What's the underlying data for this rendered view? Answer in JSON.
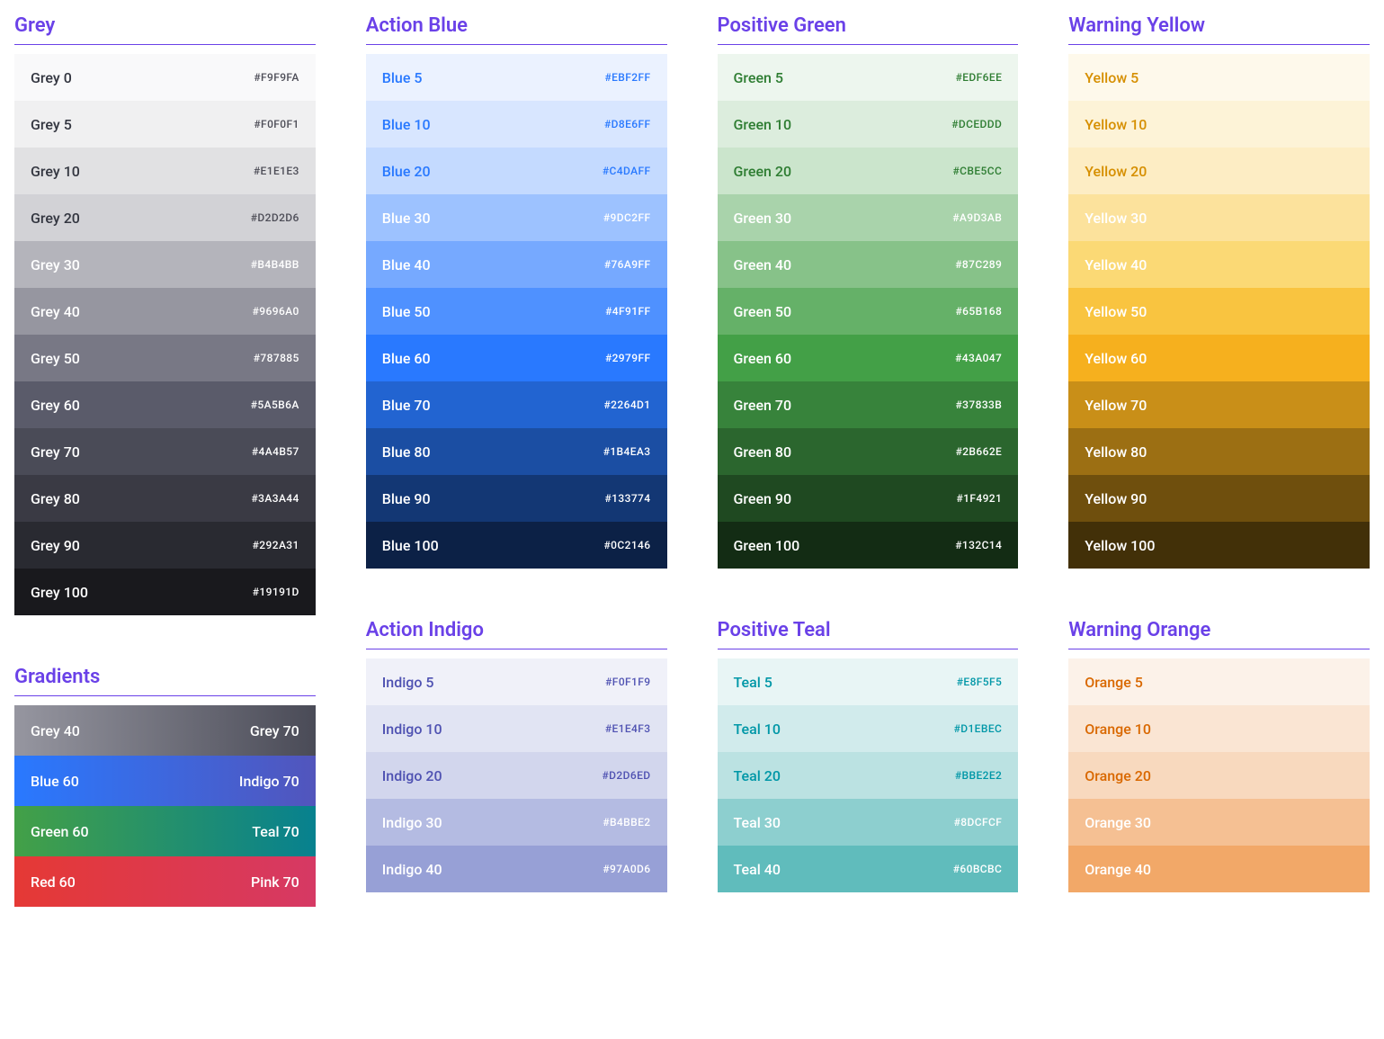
{
  "columns": [
    {
      "groups": [
        {
          "title": "Grey",
          "swatches": [
            {
              "label": "Grey 0",
              "hex": "#F9F9FA",
              "bg": "#F9F9FA",
              "fg": "#333640",
              "hexfg": "#4d4d57"
            },
            {
              "label": "Grey 5",
              "hex": "#F0F0F1",
              "bg": "#F0F0F1",
              "fg": "#333640",
              "hexfg": "#4d4d57"
            },
            {
              "label": "Grey 10",
              "hex": "#E1E1E3",
              "bg": "#E1E1E3",
              "fg": "#333640",
              "hexfg": "#4d4d57"
            },
            {
              "label": "Grey 20",
              "hex": "#D2D2D6",
              "bg": "#D2D2D6",
              "fg": "#333640",
              "hexfg": "#4d4d57"
            },
            {
              "label": "Grey 30",
              "hex": "#B4B4BB",
              "bg": "#B4B4BB",
              "fg": "#ffffff",
              "hexfg": "#ffffff"
            },
            {
              "label": "Grey 40",
              "hex": "#9696A0",
              "bg": "#9696A0",
              "fg": "#ffffff",
              "hexfg": "#ffffff"
            },
            {
              "label": "Grey 50",
              "hex": "#787885",
              "bg": "#787885",
              "fg": "#ffffff",
              "hexfg": "#ffffff"
            },
            {
              "label": "Grey 60",
              "hex": "#5A5B6A",
              "bg": "#5A5B6A",
              "fg": "#ffffff",
              "hexfg": "#ffffff"
            },
            {
              "label": "Grey 70",
              "hex": "#4A4B57",
              "bg": "#4A4B57",
              "fg": "#ffffff",
              "hexfg": "#ffffff"
            },
            {
              "label": "Grey 80",
              "hex": "#3A3A44",
              "bg": "#3A3A44",
              "fg": "#ffffff",
              "hexfg": "#ffffff"
            },
            {
              "label": "Grey 90",
              "hex": "#292A31",
              "bg": "#292A31",
              "fg": "#ffffff",
              "hexfg": "#ffffff"
            },
            {
              "label": "Grey 100",
              "hex": "#19191D",
              "bg": "#19191D",
              "fg": "#ffffff",
              "hexfg": "#ffffff"
            }
          ]
        },
        {
          "title": "Gradients",
          "gradients": [
            {
              "left": "Grey 40",
              "right": "Grey 70",
              "from": "#9696A0",
              "to": "#4A4B57"
            },
            {
              "left": "Blue 60",
              "right": "Indigo 70",
              "from": "#2979FF",
              "to": "#5255BC"
            },
            {
              "left": "Green 60",
              "right": "Teal 70",
              "from": "#43A047",
              "to": "#07818F"
            },
            {
              "left": "Red 60",
              "right": "Pink 70",
              "from": "#E53935",
              "to": "#D63964"
            }
          ]
        }
      ]
    },
    {
      "groups": [
        {
          "title": "Action Blue",
          "swatches": [
            {
              "label": "Blue 5",
              "hex": "#EBF2FF",
              "bg": "#EBF2FF",
              "fg": "#2979FF",
              "hexfg": "#2979FF"
            },
            {
              "label": "Blue 10",
              "hex": "#D8E6FF",
              "bg": "#D8E6FF",
              "fg": "#2979FF",
              "hexfg": "#2979FF"
            },
            {
              "label": "Blue 20",
              "hex": "#C4DAFF",
              "bg": "#C4DAFF",
              "fg": "#2979FF",
              "hexfg": "#2979FF"
            },
            {
              "label": "Blue 30",
              "hex": "#9DC2FF",
              "bg": "#9DC2FF",
              "fg": "#ffffff",
              "hexfg": "#ffffff"
            },
            {
              "label": "Blue 40",
              "hex": "#76A9FF",
              "bg": "#76A9FF",
              "fg": "#ffffff",
              "hexfg": "#ffffff"
            },
            {
              "label": "Blue 50",
              "hex": "#4F91FF",
              "bg": "#4F91FF",
              "fg": "#ffffff",
              "hexfg": "#ffffff"
            },
            {
              "label": "Blue 60",
              "hex": "#2979FF",
              "bg": "#2979FF",
              "fg": "#ffffff",
              "hexfg": "#ffffff"
            },
            {
              "label": "Blue 70",
              "hex": "#2264D1",
              "bg": "#2264D1",
              "fg": "#ffffff",
              "hexfg": "#ffffff"
            },
            {
              "label": "Blue 80",
              "hex": "#1B4EA3",
              "bg": "#1B4EA3",
              "fg": "#ffffff",
              "hexfg": "#ffffff"
            },
            {
              "label": "Blue 90",
              "hex": "#133774",
              "bg": "#133774",
              "fg": "#ffffff",
              "hexfg": "#ffffff"
            },
            {
              "label": "Blue 100",
              "hex": "#0C2146",
              "bg": "#0C2146",
              "fg": "#ffffff",
              "hexfg": "#ffffff"
            }
          ]
        },
        {
          "title": "Action Indigo",
          "swatches": [
            {
              "label": "Indigo 5",
              "hex": "#F0F1F9",
              "bg": "#F0F1F9",
              "fg": "#4F52B2",
              "hexfg": "#4F52B2"
            },
            {
              "label": "Indigo 10",
              "hex": "#E1E4F3",
              "bg": "#E1E4F3",
              "fg": "#4F52B2",
              "hexfg": "#4F52B2"
            },
            {
              "label": "Indigo 20",
              "hex": "#D2D6ED",
              "bg": "#D2D6ED",
              "fg": "#4F52B2",
              "hexfg": "#4F52B2"
            },
            {
              "label": "Indigo 30",
              "hex": "#B4BBE2",
              "bg": "#B4BBE2",
              "fg": "#ffffff",
              "hexfg": "#ffffff"
            },
            {
              "label": "Indigo 40",
              "hex": "#97A0D6",
              "bg": "#97A0D6",
              "fg": "#ffffff",
              "hexfg": "#ffffff"
            }
          ]
        }
      ]
    },
    {
      "groups": [
        {
          "title": "Positive Green",
          "swatches": [
            {
              "label": "Green 5",
              "hex": "#EDF6EE",
              "bg": "#EDF6EE",
              "fg": "#2E7D32",
              "hexfg": "#2E7D32"
            },
            {
              "label": "Green 10",
              "hex": "#DCEDDD",
              "bg": "#DCEDDD",
              "fg": "#2E7D32",
              "hexfg": "#2E7D32"
            },
            {
              "label": "Green 20",
              "hex": "#CBE5CC",
              "bg": "#CBE5CC",
              "fg": "#2E7D32",
              "hexfg": "#2E7D32"
            },
            {
              "label": "Green 30",
              "hex": "#A9D3AB",
              "bg": "#A9D3AB",
              "fg": "#ffffff",
              "hexfg": "#ffffff"
            },
            {
              "label": "Green 40",
              "hex": "#87C289",
              "bg": "#87C289",
              "fg": "#ffffff",
              "hexfg": "#ffffff"
            },
            {
              "label": "Green 50",
              "hex": "#65B168",
              "bg": "#65B168",
              "fg": "#ffffff",
              "hexfg": "#ffffff"
            },
            {
              "label": "Green 60",
              "hex": "#43A047",
              "bg": "#43A047",
              "fg": "#ffffff",
              "hexfg": "#ffffff"
            },
            {
              "label": "Green 70",
              "hex": "#37833B",
              "bg": "#37833B",
              "fg": "#ffffff",
              "hexfg": "#ffffff"
            },
            {
              "label": "Green 80",
              "hex": "#2B662E",
              "bg": "#2B662E",
              "fg": "#ffffff",
              "hexfg": "#ffffff"
            },
            {
              "label": "Green 90",
              "hex": "#1F4921",
              "bg": "#1F4921",
              "fg": "#ffffff",
              "hexfg": "#ffffff"
            },
            {
              "label": "Green 100",
              "hex": "#132C14",
              "bg": "#132C14",
              "fg": "#ffffff",
              "hexfg": "#ffffff"
            }
          ]
        },
        {
          "title": "Positive Teal",
          "swatches": [
            {
              "label": "Teal 5",
              "hex": "#E8F5F5",
              "bg": "#E8F5F5",
              "fg": "#0097A7",
              "hexfg": "#0097A7"
            },
            {
              "label": "Teal 10",
              "hex": "#D1EBEC",
              "bg": "#D1EBEC",
              "fg": "#0097A7",
              "hexfg": "#0097A7"
            },
            {
              "label": "Teal 20",
              "hex": "#BBE2E2",
              "bg": "#BBE2E2",
              "fg": "#0097A7",
              "hexfg": "#0097A7"
            },
            {
              "label": "Teal 30",
              "hex": "#8DCFCF",
              "bg": "#8DCFCF",
              "fg": "#ffffff",
              "hexfg": "#ffffff"
            },
            {
              "label": "Teal 40",
              "hex": "#60BCBC",
              "bg": "#60BCBC",
              "fg": "#ffffff",
              "hexfg": "#ffffff"
            }
          ]
        }
      ]
    },
    {
      "groups": [
        {
          "title": "Warning Yellow",
          "swatches": [
            {
              "label": "Yellow 5",
              "hex": "",
              "bg": "#FEF9EB",
              "fg": "#D68F00",
              "hexfg": "#D68F00"
            },
            {
              "label": "Yellow 10",
              "hex": "",
              "bg": "#FDF3D7",
              "fg": "#D68F00",
              "hexfg": "#D68F00"
            },
            {
              "label": "Yellow 20",
              "hex": "",
              "bg": "#FDEDC4",
              "fg": "#D68F00",
              "hexfg": "#D68F00"
            },
            {
              "label": "Yellow 30",
              "hex": "",
              "bg": "#FCE29C",
              "fg": "#ffffff",
              "hexfg": "#ffffff"
            },
            {
              "label": "Yellow 40",
              "hex": "",
              "bg": "#FBD975",
              "fg": "#ffffff",
              "hexfg": "#ffffff"
            },
            {
              "label": "Yellow 50",
              "hex": "",
              "bg": "#F9C440",
              "fg": "#ffffff",
              "hexfg": "#ffffff"
            },
            {
              "label": "Yellow 60",
              "hex": "",
              "bg": "#F6B01E",
              "fg": "#ffffff",
              "hexfg": "#ffffff"
            },
            {
              "label": "Yellow 70",
              "hex": "",
              "bg": "#C98F18",
              "fg": "#ffffff",
              "hexfg": "#ffffff"
            },
            {
              "label": "Yellow 80",
              "hex": "",
              "bg": "#9C6F13",
              "fg": "#ffffff",
              "hexfg": "#ffffff"
            },
            {
              "label": "Yellow 90",
              "hex": "",
              "bg": "#6F4F0D",
              "fg": "#ffffff",
              "hexfg": "#ffffff"
            },
            {
              "label": "Yellow 100",
              "hex": "",
              "bg": "#423008",
              "fg": "#ffffff",
              "hexfg": "#ffffff"
            }
          ]
        },
        {
          "title": "Warning Orange",
          "swatches": [
            {
              "label": "Orange 5",
              "hex": "",
              "bg": "#FCF2E9",
              "fg": "#D96800",
              "hexfg": "#D96800"
            },
            {
              "label": "Orange 10",
              "hex": "",
              "bg": "#FAE5D3",
              "fg": "#D96800",
              "hexfg": "#D96800"
            },
            {
              "label": "Orange 20",
              "hex": "",
              "bg": "#F8D9BE",
              "fg": "#D96800",
              "hexfg": "#D96800"
            },
            {
              "label": "Orange 30",
              "hex": "",
              "bg": "#F5C093",
              "fg": "#ffffff",
              "hexfg": "#ffffff"
            },
            {
              "label": "Orange 40",
              "hex": "",
              "bg": "#F2A868",
              "fg": "#ffffff",
              "hexfg": "#ffffff"
            }
          ]
        }
      ]
    }
  ]
}
